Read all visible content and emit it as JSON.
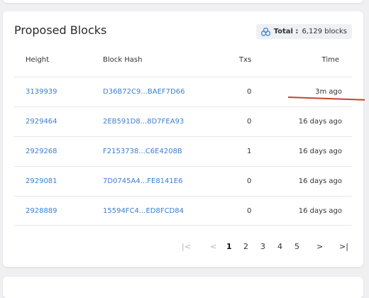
{
  "card": {
    "title": "Proposed Blocks",
    "total_label": "Total :",
    "total_value": "6,129 blocks"
  },
  "table": {
    "headers": [
      "Height",
      "Block Hash",
      "Txs",
      "Time"
    ],
    "rows": [
      {
        "height": "3139939",
        "hash": "D36B72C9...BAEF7D66",
        "txs": "0",
        "time": "3m ago"
      },
      {
        "height": "2929464",
        "hash": "2EB591D8...8D7FEA93",
        "txs": "0",
        "time": "16 days ago"
      },
      {
        "height": "2929268",
        "hash": "F2153738...C6E4208B",
        "txs": "1",
        "time": "16 days ago"
      },
      {
        "height": "2929081",
        "hash": "7D0745A4...FE8141E6",
        "txs": "0",
        "time": "16 days ago"
      },
      {
        "height": "2928889",
        "hash": "15594FC4...ED8FCD84",
        "txs": "0",
        "time": "16 days ago"
      }
    ]
  },
  "pagination": {
    "first": "|<",
    "prev": "<",
    "pages": [
      "1",
      "2",
      "3",
      "4",
      "5"
    ],
    "current_page": "1",
    "next": ">",
    "last": ">|"
  },
  "colors": {
    "link": "#3b7fd0",
    "annotation": "#c8442a",
    "badge_icon": "#4a90d9"
  },
  "icons": {
    "total_badge": "stack-layers-icon"
  }
}
